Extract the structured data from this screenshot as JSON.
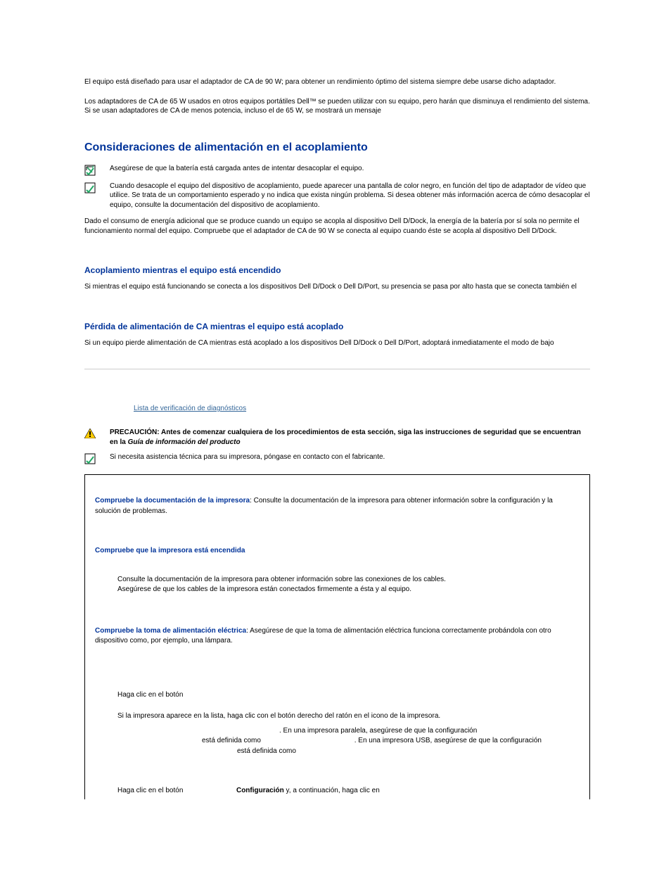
{
  "intro": {
    "p1": "El equipo está diseñado para usar el adaptador de CA de 90 W; para obtener un rendimiento óptimo del sistema siempre debe usarse dicho adaptador.",
    "p2": "Los adaptadores de CA de 65 W usados en otros equipos portátiles Dell™ se pueden utilizar con su equipo, pero harán que disminuya el rendimiento del sistema. Si se usan adaptadores de CA de menos potencia, incluso el de 65 W, se mostrará un mensaje"
  },
  "h_consider": "Consideraciones de alimentación en el acoplamiento",
  "note1": "Asegúrese de que la batería está cargada antes de intentar desacoplar el equipo.",
  "note2": "Cuando desacople el equipo del dispositivo de acoplamiento, puede aparecer una pantalla de color negro, en función del tipo de adaptador de vídeo que utilice. Se trata de un comportamiento esperado y no indica que exista ningún problema. Si desea obtener más información acerca de cómo desacoplar el equipo, consulte la documentación del dispositivo de acoplamiento.",
  "consider_p": "Dado el consumo de energía adicional que se produce cuando un equipo se acopla al dispositivo Dell D/Dock, la energía de la batería por sí sola no permite el funcionamiento normal del equipo. Compruebe que el adaptador de CA de 90 W se conecta al equipo cuando éste se acopla al dispositivo Dell D/Dock.",
  "h_dock_on": "Acoplamiento mientras el equipo está encendido",
  "dock_on_p": "Si mientras el equipo está funcionando se conecta a los dispositivos Dell D/Dock o Dell D/Port, su presencia se pasa por alto hasta que se conecta también el",
  "h_power_loss": "Pérdida de alimentación de CA mientras el equipo está acoplado",
  "power_loss_p": "Si un equipo pierde alimentación de CA mientras está acoplado a los dispositivos Dell D/Dock o Dell D/Port, adoptará inmediatamente el modo de bajo",
  "diag_link": "Lista de verificación de diagnósticos",
  "caution_label": "PRECAUCIÓN: ",
  "caution_text": "Antes de comenzar cualquiera de los procedimientos de esta sección, siga las instrucciones de seguridad que se encuentran en la ",
  "caution_ital": "Guía de información del producto",
  "note3": "Si necesita asistencia técnica para su impresora, póngase en contacto con el fabricante.",
  "tbl": {
    "r1_label": "Compruebe la documentación de la impresora",
    "r1_text": ": Consulte la documentación de la impresora para obtener información sobre la configuración y la solución de problemas.",
    "r2_label": "Compruebe que la impresora está encendida",
    "r3a": "Consulte la documentación de la impresora para obtener información sobre las conexiones de los cables.",
    "r3b": "Asegúrese de que los cables de la impresora están conectados firmemente a ésta y al equipo.",
    "r4_label": "Compruebe la toma de alimentación eléctrica",
    "r4_text": ": Asegúrese de que la toma de alimentación eléctrica funciona correctamente probándola con otro dispositivo como, por ejemplo, una lámpara.",
    "r5_a": "Haga clic en el botón",
    "r5_b": "Si la impresora aparece en la lista, haga clic con el botón derecho del ratón en el icono de la impresora.",
    "r5_c1": ". En una impresora paralela, asegúrese de que la configuración",
    "r5_c2": " está definida como ",
    "r5_c3": ". En una impresora USB, asegúrese de que la configuración",
    "r5_c4": " está definida como ",
    "r6_a": "Haga clic en el botón",
    "r6_b": "Configuración",
    "r6_c": " y, a continuación, haga clic en"
  }
}
